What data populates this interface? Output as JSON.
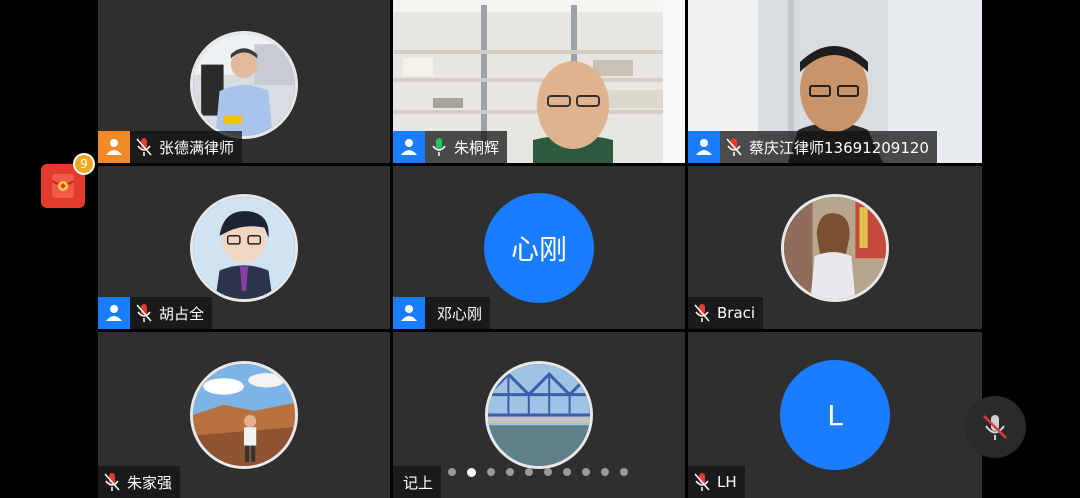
{
  "notification": {
    "count": "9",
    "icon": "red-envelope-icon"
  },
  "colors": {
    "host_badge": "#1a7cff",
    "host_badge_alt": "#f08a24",
    "letter_avatar": "#1a7cff",
    "speaking_mic": "#22c55e",
    "muted_mic": "#e33b2e"
  },
  "participants": [
    {
      "name": "张德满律师",
      "mic": "muted",
      "host_icon": "orange",
      "kind": "photo"
    },
    {
      "name": "朱桐辉",
      "mic": "speaking",
      "host_icon": "blue",
      "kind": "video"
    },
    {
      "name": "蔡庆江律师13691209120",
      "mic": "muted",
      "host_icon": "blue",
      "kind": "video"
    },
    {
      "name": "胡占全",
      "mic": "muted",
      "host_icon": "blue",
      "kind": "photo"
    },
    {
      "name": "邓心刚",
      "mic": "none",
      "host_icon": "blue",
      "kind": "letter",
      "initials": "心刚"
    },
    {
      "name": "Braci",
      "mic": "muted",
      "host_icon": "none",
      "kind": "photo"
    },
    {
      "name": "朱家强",
      "mic": "muted",
      "host_icon": "none",
      "kind": "photo"
    },
    {
      "name": "记上",
      "mic": "none",
      "host_icon": "none",
      "kind": "photo"
    },
    {
      "name": "LH",
      "mic": "muted",
      "host_icon": "none",
      "kind": "letter",
      "initials": "L"
    }
  ],
  "pagination": {
    "total": 10,
    "current": 2
  },
  "controls": {
    "mute_button": "muted-mic-icon"
  }
}
